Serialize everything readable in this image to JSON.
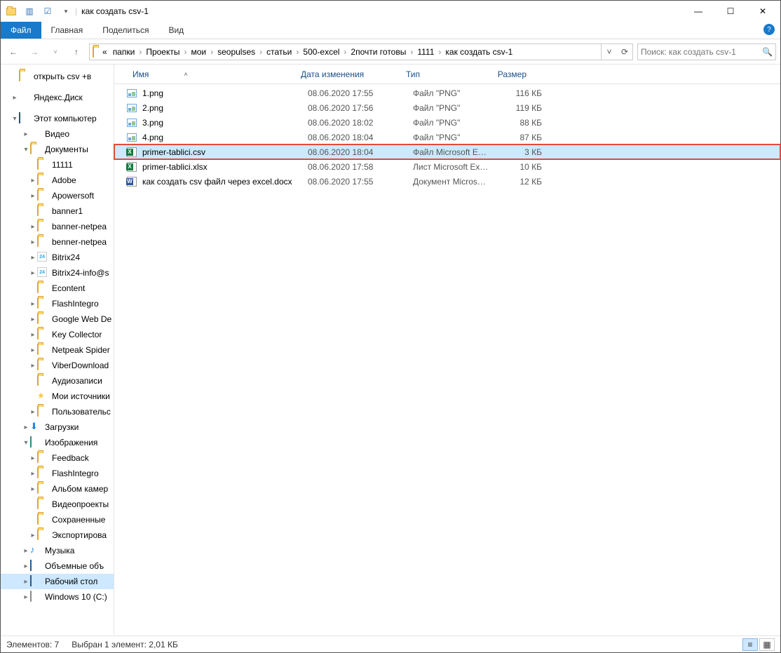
{
  "title": "как создать csv-1",
  "ribbon": {
    "file": "Файл",
    "home": "Главная",
    "share": "Поделиться",
    "view": "Вид"
  },
  "breadcrumb": [
    "папки",
    "Проекты",
    "мои",
    "seopulses",
    "статьи",
    "500-excel",
    "2почти готовы",
    "1111",
    "как создать csv-1"
  ],
  "bc_prefix": "«",
  "search_placeholder": "Поиск: как создать csv-1",
  "cols": {
    "name": "Имя",
    "date": "Дата изменения",
    "type": "Тип",
    "size": "Размер"
  },
  "files": [
    {
      "icon": "img",
      "name": "1.png",
      "date": "08.06.2020 17:55",
      "type": "Файл \"PNG\"",
      "size": "116 КБ",
      "sel": false
    },
    {
      "icon": "img",
      "name": "2.png",
      "date": "08.06.2020 17:56",
      "type": "Файл \"PNG\"",
      "size": "119 КБ",
      "sel": false
    },
    {
      "icon": "img",
      "name": "3.png",
      "date": "08.06.2020 18:02",
      "type": "Файл \"PNG\"",
      "size": "88 КБ",
      "sel": false
    },
    {
      "icon": "img",
      "name": "4.png",
      "date": "08.06.2020 18:04",
      "type": "Файл \"PNG\"",
      "size": "87 КБ",
      "sel": false
    },
    {
      "icon": "xls",
      "name": "primer-tablici.csv",
      "date": "08.06.2020 18:04",
      "type": "Файл Microsoft E…",
      "size": "3 КБ",
      "sel": true
    },
    {
      "icon": "xls",
      "name": "primer-tablici.xlsx",
      "date": "08.06.2020 17:58",
      "type": "Лист Microsoft Ex…",
      "size": "10 КБ",
      "sel": false
    },
    {
      "icon": "doc",
      "name": "как создать csv файл через excel.docx",
      "date": "08.06.2020 17:55",
      "type": "Документ Micros…",
      "size": "12 КБ",
      "sel": false
    }
  ],
  "tree": [
    {
      "d": 1,
      "icon": "folder",
      "label": "открыть csv +в",
      "exp": ""
    },
    {
      "d": 0,
      "spacer": true
    },
    {
      "d": 1,
      "icon": "yd",
      "label": "Яндекс.Диск",
      "exp": "▸"
    },
    {
      "d": 0,
      "spacer": true
    },
    {
      "d": 1,
      "icon": "pc",
      "label": "Этот компьютер",
      "exp": "▾"
    },
    {
      "d": 2,
      "icon": "vid",
      "label": "Видео",
      "exp": "▸"
    },
    {
      "d": 2,
      "icon": "doc2",
      "label": "Документы",
      "exp": "▾"
    },
    {
      "d": 3,
      "icon": "folder",
      "label": "11111"
    },
    {
      "d": 3,
      "icon": "folder",
      "label": "Adobe",
      "exp": "▸"
    },
    {
      "d": 3,
      "icon": "folder",
      "label": "Apowersoft",
      "exp": "▸"
    },
    {
      "d": 3,
      "icon": "folder",
      "label": "banner1"
    },
    {
      "d": 3,
      "icon": "folder",
      "label": "banner-netpea",
      "exp": "▸"
    },
    {
      "d": 3,
      "icon": "folder",
      "label": "benner-netpea",
      "exp": "▸"
    },
    {
      "d": 3,
      "icon": "b24",
      "label": "Bitrix24",
      "exp": "▸"
    },
    {
      "d": 3,
      "icon": "b24",
      "label": "Bitrix24-info@s",
      "exp": "▸"
    },
    {
      "d": 3,
      "icon": "folder",
      "label": "Econtent"
    },
    {
      "d": 3,
      "icon": "folder",
      "label": "FlashIntegro",
      "exp": "▸"
    },
    {
      "d": 3,
      "icon": "folder",
      "label": "Google Web De",
      "exp": "▸"
    },
    {
      "d": 3,
      "icon": "folder",
      "label": "Key Collector",
      "exp": "▸"
    },
    {
      "d": 3,
      "icon": "folder",
      "label": "Netpeak Spider",
      "exp": "▸"
    },
    {
      "d": 3,
      "icon": "folder",
      "label": "ViberDownload",
      "exp": "▸"
    },
    {
      "d": 3,
      "icon": "folder",
      "label": "Аудиозаписи"
    },
    {
      "d": 3,
      "icon": "star",
      "label": "Мои источники"
    },
    {
      "d": 3,
      "icon": "folder",
      "label": "Пользовательс",
      "exp": "▸"
    },
    {
      "d": 2,
      "icon": "dl",
      "label": "Загрузки",
      "exp": "▸"
    },
    {
      "d": 2,
      "icon": "pic",
      "label": "Изображения",
      "exp": "▾"
    },
    {
      "d": 3,
      "icon": "folder",
      "label": "Feedback",
      "exp": "▸"
    },
    {
      "d": 3,
      "icon": "folder",
      "label": "FlashIntegro",
      "exp": "▸"
    },
    {
      "d": 3,
      "icon": "folder",
      "label": "Альбом камер",
      "exp": "▸"
    },
    {
      "d": 3,
      "icon": "folder",
      "label": "Видеопроекты"
    },
    {
      "d": 3,
      "icon": "folder",
      "label": "Сохраненные"
    },
    {
      "d": 3,
      "icon": "folder",
      "label": "Экспортирова",
      "exp": "▸"
    },
    {
      "d": 2,
      "icon": "mus",
      "label": "Музыка",
      "exp": "▸"
    },
    {
      "d": 2,
      "icon": "deskt",
      "label": "Объемные объ",
      "exp": "▸"
    },
    {
      "d": 2,
      "icon": "deskt",
      "label": "Рабочий стол",
      "exp": "▸",
      "sel": true
    },
    {
      "d": 2,
      "icon": "disk",
      "label": "Windows 10 (C:)",
      "exp": "▸"
    }
  ],
  "status": {
    "items": "Элементов: 7",
    "sel": "Выбран 1 элемент: 2,01 КБ"
  }
}
